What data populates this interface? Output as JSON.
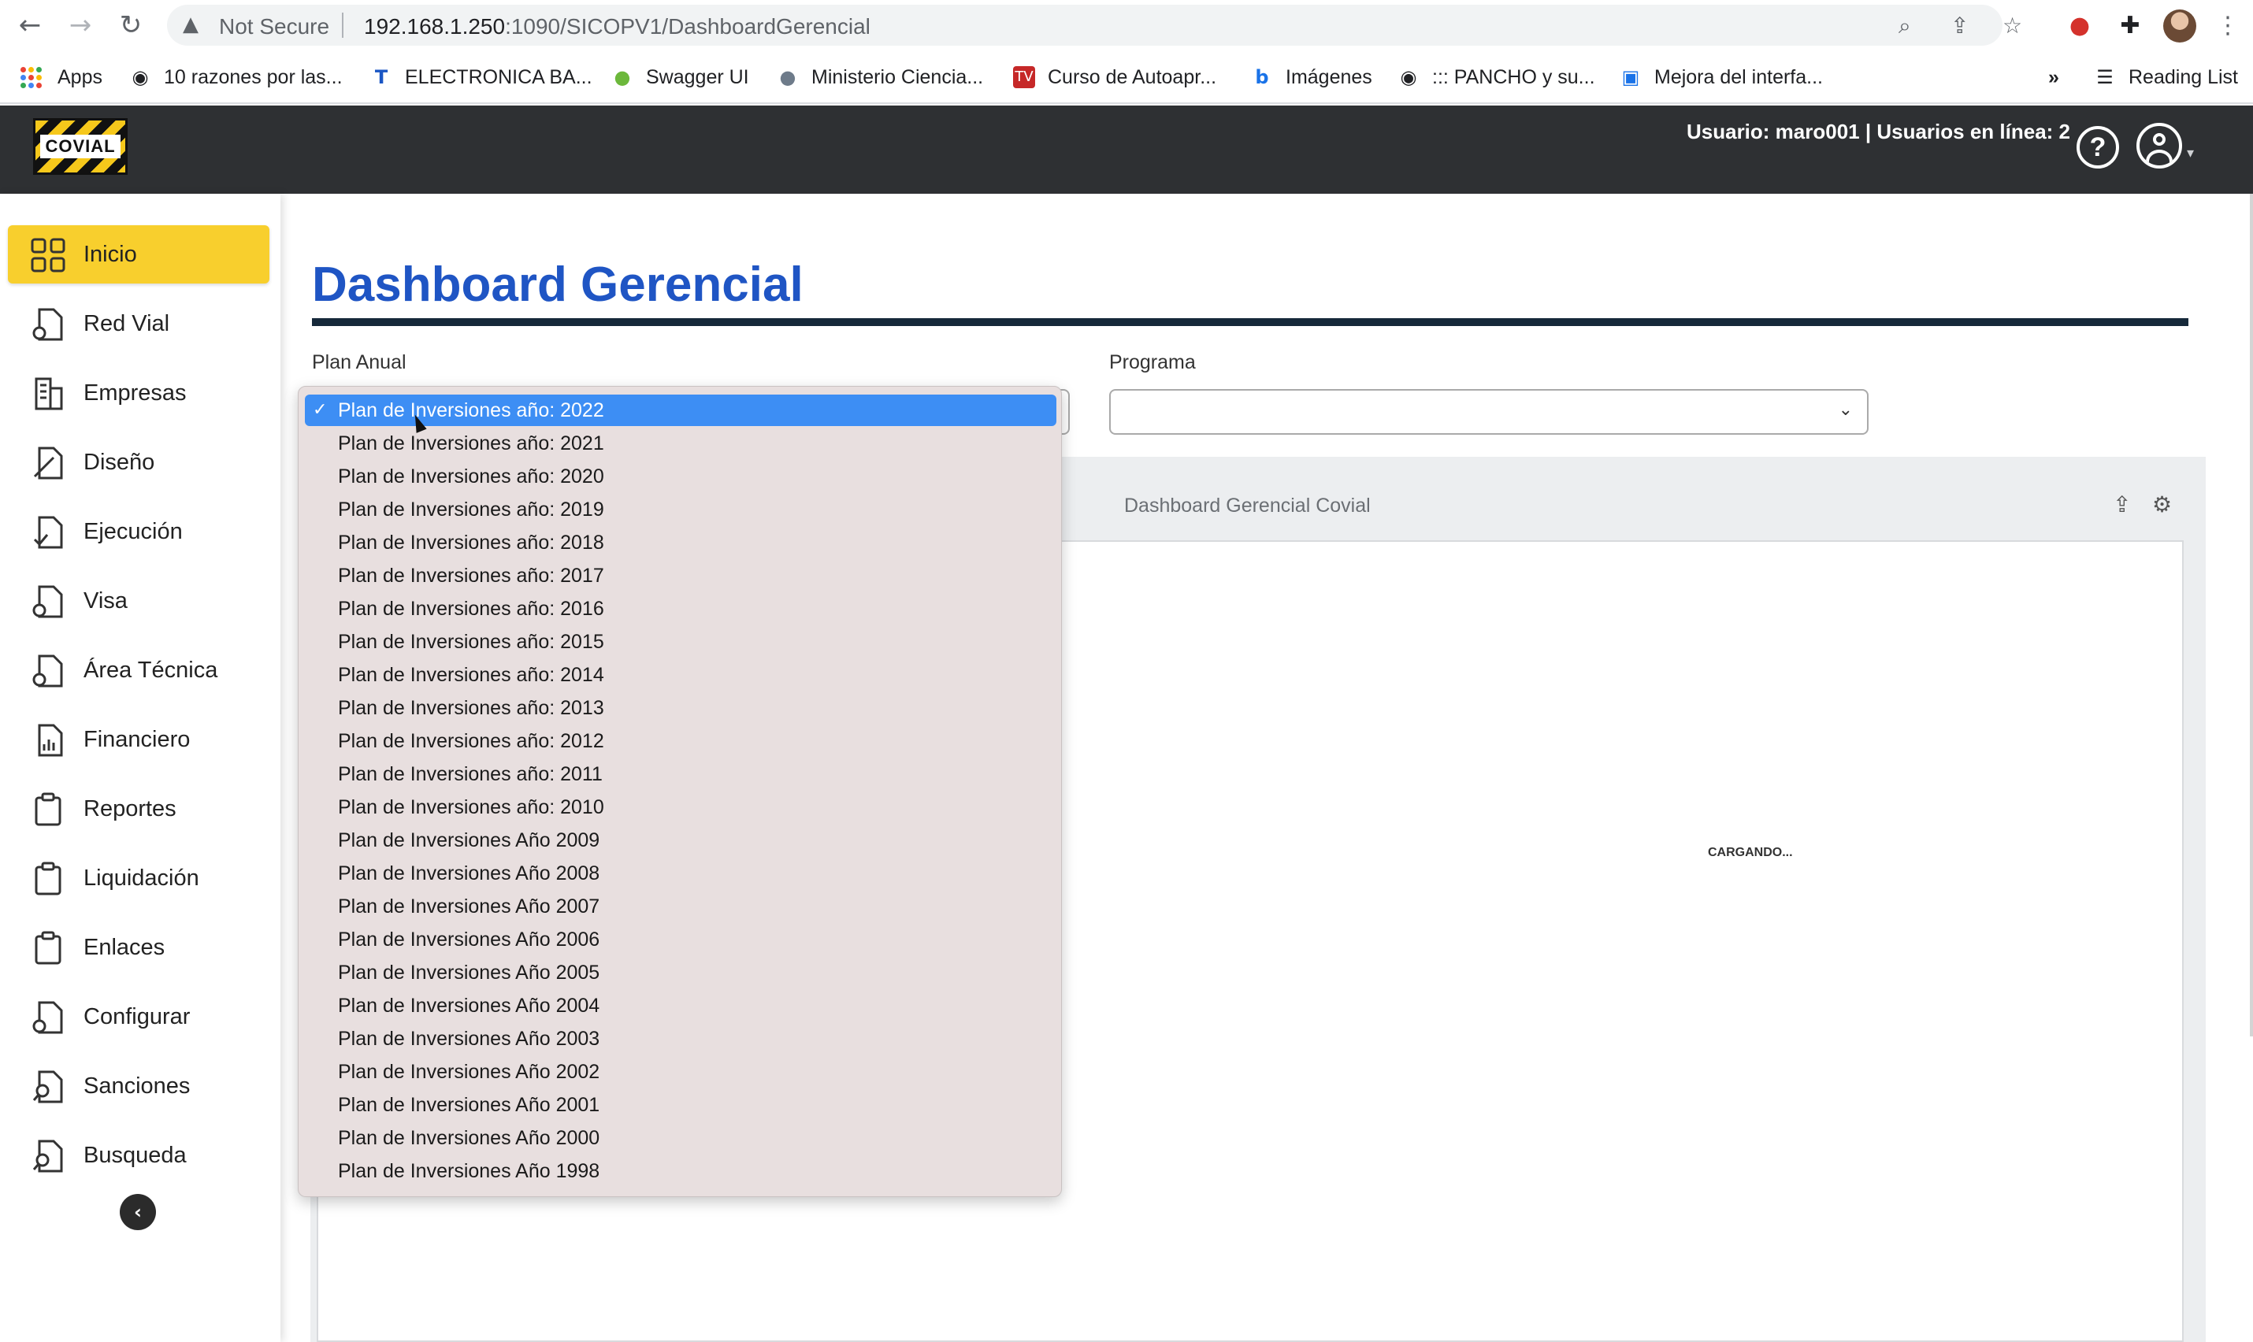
{
  "browser": {
    "security_label": "Not Secure",
    "url_host": "192.168.1.250",
    "url_rest": ":1090/SICOPV1/DashboardGerencial",
    "bookmarks_overflow": "»",
    "reading_list": "Reading List",
    "bookmarks": [
      {
        "label": "Apps",
        "icon": "apps-grid-icon"
      },
      {
        "label": "10 razones por las...",
        "icon": "globe-icon"
      },
      {
        "label": "ELECTRONICA BA...",
        "icon": "t-logo-icon"
      },
      {
        "label": "Swagger UI",
        "icon": "swagger-icon"
      },
      {
        "label": "Ministerio Ciencia...",
        "icon": "sphere-icon"
      },
      {
        "label": "Curso de Autoapr...",
        "icon": "tv-icon"
      },
      {
        "label": "Imágenes",
        "icon": "bing-icon"
      },
      {
        "label": "::: PANCHO y su...",
        "icon": "globe-icon"
      },
      {
        "label": "Mejora del interfa...",
        "icon": "window-icon"
      }
    ]
  },
  "header": {
    "logo_text": "COVIAL",
    "user_info": "Usuario: maro001 | Usuarios en línea: 2",
    "help_icon_label": "?"
  },
  "sidebar": {
    "items": [
      {
        "label": "Inicio",
        "icon": "grid-icon",
        "active": true
      },
      {
        "label": "Red Vial",
        "icon": "doc-gear-icon"
      },
      {
        "label": "Empresas",
        "icon": "building-icon"
      },
      {
        "label": "Diseño",
        "icon": "doc-ruler-icon"
      },
      {
        "label": "Ejecución",
        "icon": "doc-check-icon"
      },
      {
        "label": "Visa",
        "icon": "doc-gear-icon"
      },
      {
        "label": "Área Técnica",
        "icon": "doc-gear-icon"
      },
      {
        "label": "Financiero",
        "icon": "doc-chart-icon"
      },
      {
        "label": "Reportes",
        "icon": "clipboard-icon"
      },
      {
        "label": "Liquidación",
        "icon": "clipboard-icon"
      },
      {
        "label": "Enlaces",
        "icon": "clipboard-icon"
      },
      {
        "label": "Configurar",
        "icon": "doc-gear-icon"
      },
      {
        "label": "Sanciones",
        "icon": "doc-search-icon"
      },
      {
        "label": "Busqueda",
        "icon": "doc-search-icon"
      }
    ]
  },
  "main": {
    "title": "Dashboard Gerencial",
    "plan_label": "Plan Anual",
    "programa_label": "Programa",
    "programa_value": "",
    "panel_title": "Dashboard Gerencial Covial",
    "loading_text": "CARGANDO..."
  },
  "dropdown": {
    "selected_index": 0,
    "check_mark": "✓",
    "options": [
      "Plan de Inversiones año: 2022",
      "Plan de Inversiones año: 2021",
      "Plan de Inversiones año: 2020",
      "Plan de Inversiones año: 2019",
      "Plan de Inversiones año: 2018",
      "Plan de Inversiones año: 2017",
      "Plan de Inversiones año: 2016",
      "Plan de Inversiones año: 2015",
      "Plan de Inversiones año: 2014",
      "Plan de Inversiones año: 2013",
      "Plan de Inversiones año: 2012",
      "Plan de Inversiones año: 2011",
      "Plan de Inversiones año: 2010",
      "Plan de Inversiones Año 2009",
      "Plan de Inversiones Año 2008",
      "Plan de Inversiones Año 2007",
      "Plan de Inversiones Año 2006",
      "Plan de Inversiones Año 2005",
      "Plan de Inversiones Año 2004",
      "Plan de Inversiones Año 2003",
      "Plan de Inversiones Año 2002",
      "Plan de Inversiones Año 2001",
      "Plan de Inversiones Año 2000",
      "Plan de Inversiones Año 1998"
    ]
  },
  "colors": {
    "accent_yellow": "#f8cf2d",
    "title_blue": "#1f55c4",
    "header_dark": "#2e3033",
    "selection_blue": "#3d8ef4"
  }
}
